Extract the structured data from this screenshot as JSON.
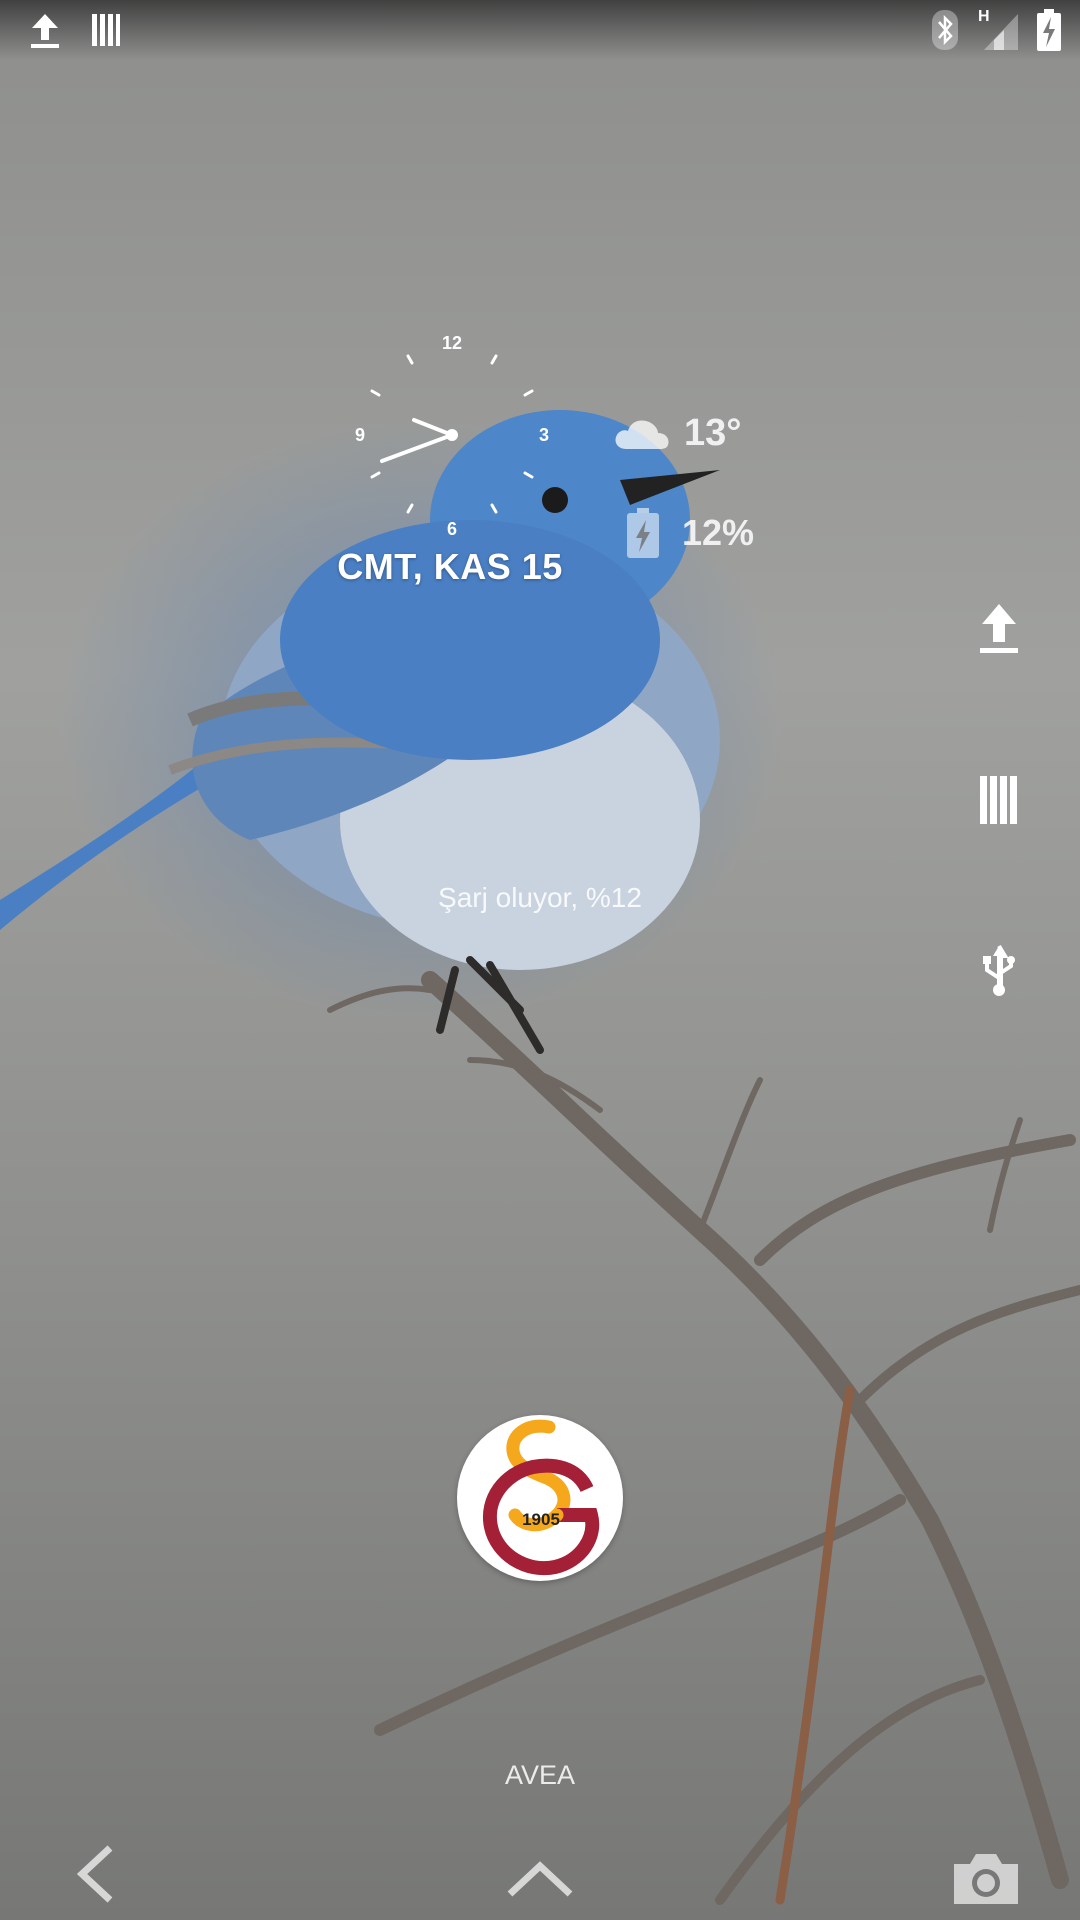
{
  "status_bar": {
    "left_icons": [
      "upload-icon",
      "barcode-icon"
    ],
    "right_icons": [
      "bluetooth-icon",
      "signal-h-icon",
      "battery-charging-icon"
    ],
    "network_type": "H"
  },
  "clock": {
    "numerals": {
      "n12": "12",
      "n3": "3",
      "n6": "6",
      "n9": "9"
    },
    "date": "CMT, KAS 15"
  },
  "weather": {
    "icon": "cloud-icon",
    "temperature": "13°"
  },
  "battery": {
    "icon": "battery-charging-icon",
    "percent": "12%"
  },
  "notification_icons": [
    "upload-icon",
    "barcode-icon",
    "usb-icon"
  ],
  "charging_status": "Şarj oluyor, %12",
  "lock_avatar": {
    "icon": "galatasaray-logo-icon",
    "year": "1905"
  },
  "carrier": "AVEA",
  "navbar": {
    "left": "back-chevron-icon",
    "center": "unlock-chevron-up-icon",
    "right": "camera-icon"
  },
  "colors": {
    "logo_yellow": "#f6a81c",
    "logo_red": "#a32036",
    "bird_blue": "#4a7fc4"
  }
}
